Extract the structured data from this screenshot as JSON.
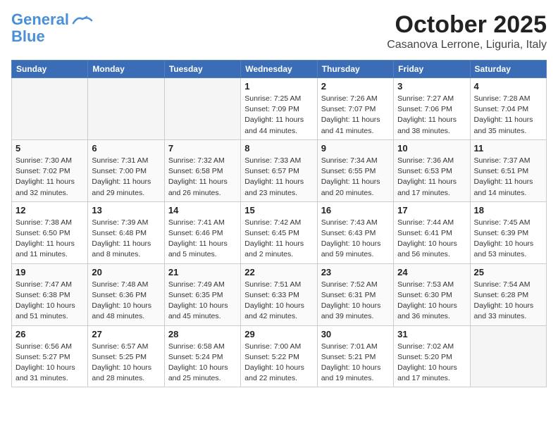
{
  "header": {
    "logo_line1": "General",
    "logo_line2": "Blue",
    "month": "October 2025",
    "location": "Casanova Lerrone, Liguria, Italy"
  },
  "days_of_week": [
    "Sunday",
    "Monday",
    "Tuesday",
    "Wednesday",
    "Thursday",
    "Friday",
    "Saturday"
  ],
  "weeks": [
    [
      {
        "day": "",
        "info": ""
      },
      {
        "day": "",
        "info": ""
      },
      {
        "day": "",
        "info": ""
      },
      {
        "day": "1",
        "info": "Sunrise: 7:25 AM\nSunset: 7:09 PM\nDaylight: 11 hours and 44 minutes."
      },
      {
        "day": "2",
        "info": "Sunrise: 7:26 AM\nSunset: 7:07 PM\nDaylight: 11 hours and 41 minutes."
      },
      {
        "day": "3",
        "info": "Sunrise: 7:27 AM\nSunset: 7:06 PM\nDaylight: 11 hours and 38 minutes."
      },
      {
        "day": "4",
        "info": "Sunrise: 7:28 AM\nSunset: 7:04 PM\nDaylight: 11 hours and 35 minutes."
      }
    ],
    [
      {
        "day": "5",
        "info": "Sunrise: 7:30 AM\nSunset: 7:02 PM\nDaylight: 11 hours and 32 minutes."
      },
      {
        "day": "6",
        "info": "Sunrise: 7:31 AM\nSunset: 7:00 PM\nDaylight: 11 hours and 29 minutes."
      },
      {
        "day": "7",
        "info": "Sunrise: 7:32 AM\nSunset: 6:58 PM\nDaylight: 11 hours and 26 minutes."
      },
      {
        "day": "8",
        "info": "Sunrise: 7:33 AM\nSunset: 6:57 PM\nDaylight: 11 hours and 23 minutes."
      },
      {
        "day": "9",
        "info": "Sunrise: 7:34 AM\nSunset: 6:55 PM\nDaylight: 11 hours and 20 minutes."
      },
      {
        "day": "10",
        "info": "Sunrise: 7:36 AM\nSunset: 6:53 PM\nDaylight: 11 hours and 17 minutes."
      },
      {
        "day": "11",
        "info": "Sunrise: 7:37 AM\nSunset: 6:51 PM\nDaylight: 11 hours and 14 minutes."
      }
    ],
    [
      {
        "day": "12",
        "info": "Sunrise: 7:38 AM\nSunset: 6:50 PM\nDaylight: 11 hours and 11 minutes."
      },
      {
        "day": "13",
        "info": "Sunrise: 7:39 AM\nSunset: 6:48 PM\nDaylight: 11 hours and 8 minutes."
      },
      {
        "day": "14",
        "info": "Sunrise: 7:41 AM\nSunset: 6:46 PM\nDaylight: 11 hours and 5 minutes."
      },
      {
        "day": "15",
        "info": "Sunrise: 7:42 AM\nSunset: 6:45 PM\nDaylight: 11 hours and 2 minutes."
      },
      {
        "day": "16",
        "info": "Sunrise: 7:43 AM\nSunset: 6:43 PM\nDaylight: 10 hours and 59 minutes."
      },
      {
        "day": "17",
        "info": "Sunrise: 7:44 AM\nSunset: 6:41 PM\nDaylight: 10 hours and 56 minutes."
      },
      {
        "day": "18",
        "info": "Sunrise: 7:45 AM\nSunset: 6:39 PM\nDaylight: 10 hours and 53 minutes."
      }
    ],
    [
      {
        "day": "19",
        "info": "Sunrise: 7:47 AM\nSunset: 6:38 PM\nDaylight: 10 hours and 51 minutes."
      },
      {
        "day": "20",
        "info": "Sunrise: 7:48 AM\nSunset: 6:36 PM\nDaylight: 10 hours and 48 minutes."
      },
      {
        "day": "21",
        "info": "Sunrise: 7:49 AM\nSunset: 6:35 PM\nDaylight: 10 hours and 45 minutes."
      },
      {
        "day": "22",
        "info": "Sunrise: 7:51 AM\nSunset: 6:33 PM\nDaylight: 10 hours and 42 minutes."
      },
      {
        "day": "23",
        "info": "Sunrise: 7:52 AM\nSunset: 6:31 PM\nDaylight: 10 hours and 39 minutes."
      },
      {
        "day": "24",
        "info": "Sunrise: 7:53 AM\nSunset: 6:30 PM\nDaylight: 10 hours and 36 minutes."
      },
      {
        "day": "25",
        "info": "Sunrise: 7:54 AM\nSunset: 6:28 PM\nDaylight: 10 hours and 33 minutes."
      }
    ],
    [
      {
        "day": "26",
        "info": "Sunrise: 6:56 AM\nSunset: 5:27 PM\nDaylight: 10 hours and 31 minutes."
      },
      {
        "day": "27",
        "info": "Sunrise: 6:57 AM\nSunset: 5:25 PM\nDaylight: 10 hours and 28 minutes."
      },
      {
        "day": "28",
        "info": "Sunrise: 6:58 AM\nSunset: 5:24 PM\nDaylight: 10 hours and 25 minutes."
      },
      {
        "day": "29",
        "info": "Sunrise: 7:00 AM\nSunset: 5:22 PM\nDaylight: 10 hours and 22 minutes."
      },
      {
        "day": "30",
        "info": "Sunrise: 7:01 AM\nSunset: 5:21 PM\nDaylight: 10 hours and 19 minutes."
      },
      {
        "day": "31",
        "info": "Sunrise: 7:02 AM\nSunset: 5:20 PM\nDaylight: 10 hours and 17 minutes."
      },
      {
        "day": "",
        "info": ""
      }
    ]
  ]
}
